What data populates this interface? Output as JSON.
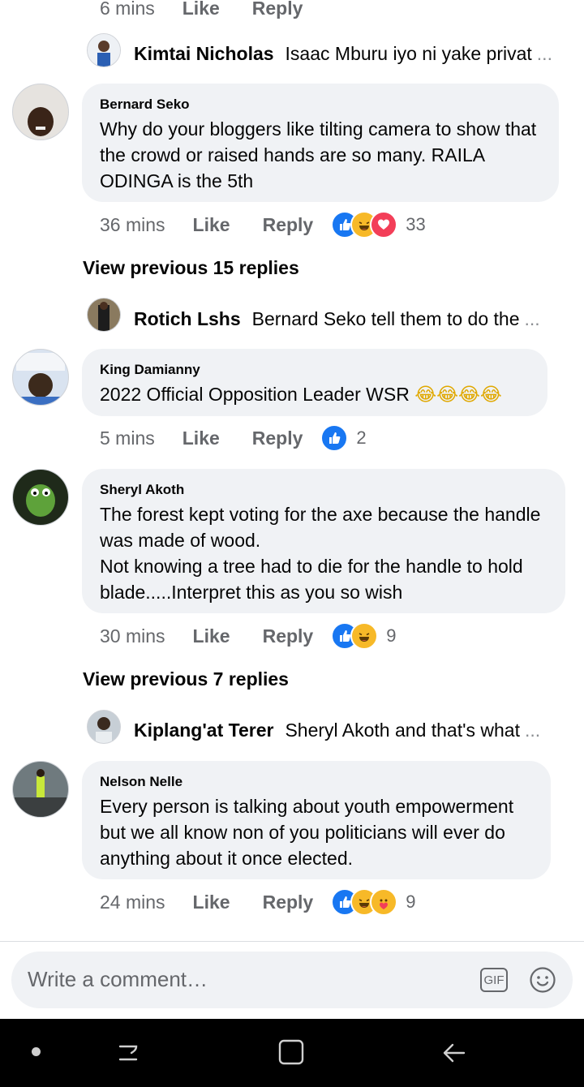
{
  "top_meta": {
    "time": "6 mins",
    "like": "Like",
    "reply": "Reply"
  },
  "comments": [
    {
      "reply_preview": {
        "name": "Kimtai Nicholas",
        "text": "Isaac Mburu iyo ni yake privat",
        "ellipsis": "..."
      }
    },
    {
      "name": "Bernard Seko",
      "text": "Why do your bloggers like tilting camera to show that the crowd or raised hands are so many. RAILA ODINGA is the 5th",
      "time": "36 mins",
      "like": "Like",
      "reply": "Reply",
      "reaction_count": "33",
      "view_previous": "View previous 15 replies",
      "reply_preview": {
        "name": "Rotich Lshs",
        "text": "Bernard Seko tell them to do the",
        "ellipsis": "..."
      }
    },
    {
      "name": "King Damianny",
      "text": "2022 Official Opposition Leader WSR",
      "emoji": "😂😂😂😂",
      "time": "5 mins",
      "like": "Like",
      "reply": "Reply",
      "reaction_count": "2"
    },
    {
      "name": "Sheryl Akoth",
      "text": "The forest kept voting for the axe because the handle was made of wood.\nNot knowing a tree had to die for the handle to hold blade.....Interpret this as you so wish",
      "time": "30 mins",
      "like": "Like",
      "reply": "Reply",
      "reaction_count": "9",
      "view_previous": "View previous 7 replies",
      "reply_preview": {
        "name": "Kiplang'at Terer",
        "text": "Sheryl Akoth and that's what",
        "ellipsis": "..."
      }
    },
    {
      "name": "Nelson Nelle",
      "text": "Every person is talking about youth empowerment but we all know non of you politicians will ever do anything about it once elected.",
      "time": "24 mins",
      "like": "Like",
      "reply": "Reply",
      "reaction_count": "9"
    }
  ],
  "composer": {
    "placeholder": "Write a comment…",
    "gif_label": "GIF"
  },
  "icons": {
    "like": "like-reaction-icon",
    "haha": "haha-reaction-icon",
    "love": "love-reaction-icon",
    "care": "care-reaction-icon",
    "gif": "gif-icon",
    "emoji": "emoji-icon",
    "nav_dot": "nav-dot-icon",
    "recents": "recents-icon",
    "home": "home-icon",
    "back": "back-icon"
  },
  "colors": {
    "accent": "#1877f2",
    "bubble": "#f0f2f5",
    "meta": "#65676b",
    "navbar": "#000000"
  }
}
